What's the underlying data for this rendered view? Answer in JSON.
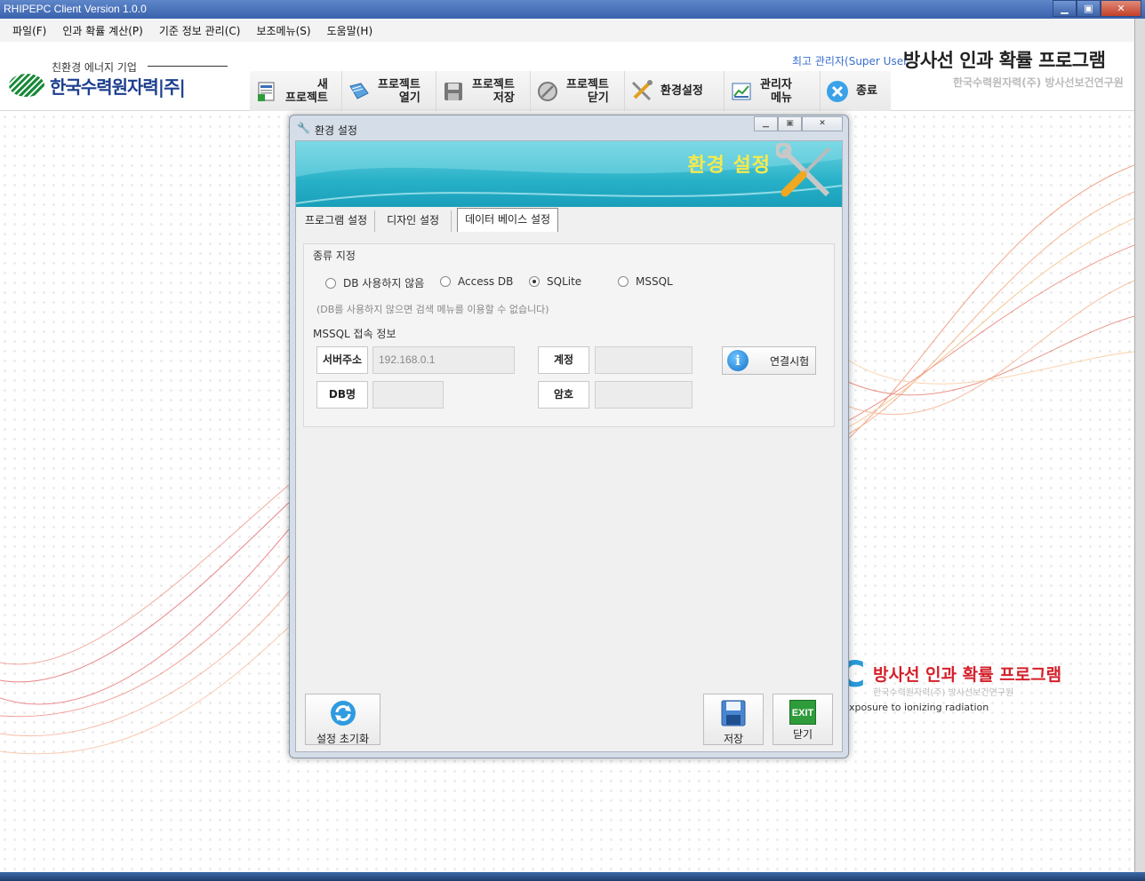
{
  "window": {
    "title": "RHIPEPC Client Version 1.0.0",
    "min": "▁",
    "max": "▣",
    "close": "✕"
  },
  "menu": [
    "파일(F)",
    "인과 확률 계산(P)",
    "기준 정보 관리(C)",
    "보조메뉴(S)",
    "도움말(H)"
  ],
  "logo": {
    "tagline": "친환경 에너지 기업",
    "name": "한국수력원자력|주|"
  },
  "toolbar": [
    {
      "label1": "새",
      "label2": "프로젝트",
      "icon": "new-project-icon"
    },
    {
      "label1": "프로젝트",
      "label2": "열기",
      "icon": "open-project-icon"
    },
    {
      "label1": "프로젝트",
      "label2": "저장",
      "icon": "save-project-icon"
    },
    {
      "label1": "프로젝트",
      "label2": "닫기",
      "icon": "close-project-icon"
    },
    {
      "label1": "환경설정",
      "label2": "",
      "icon": "settings-tools-icon"
    },
    {
      "label1": "관리자",
      "label2": "메뉴",
      "icon": "admin-chart-icon"
    },
    {
      "label1": "종료",
      "label2": "",
      "icon": "exit-x-icon"
    }
  ],
  "header": {
    "user": "최고 관리자(Super User",
    "program_title": "방사선 인과 확률 프로그램",
    "org": "한국수력원자력(주) 방사선보건연구원"
  },
  "background": {
    "title": "방사선 인과 확률 프로그램",
    "org": "한국수력원자력(주) 방사선보건연구원",
    "english": "xposure to ionizing radiation"
  },
  "dialog": {
    "title": "환경 설정",
    "banner_title": "환경 설정",
    "tabs": [
      "프로그램 설정",
      "디자인 설정",
      "데이터 베이스 설정"
    ],
    "active_tab": 2,
    "db_type": {
      "label": "종류 지정",
      "options": [
        "DB 사용하지 않음",
        "Access DB",
        "SQLite",
        "MSSQL"
      ],
      "selected": "SQLite",
      "hint": "(DB를 사용하지 않으면 검색 메뉴를 이용할 수 없습니다)"
    },
    "mssql": {
      "label": "MSSQL 접속 정보",
      "server_label": "서버주소",
      "server_value": "192.168.0.1",
      "db_label": "DB명",
      "db_value": "",
      "account_label": "계정",
      "account_value": "",
      "password_label": "암호",
      "password_value": "",
      "test_button": "연결시험"
    },
    "buttons": {
      "reset": "설정 초기화",
      "save": "저장",
      "close": "닫기",
      "exit_badge": "EXIT"
    }
  },
  "colors": {
    "banner": "#27b1c8",
    "banner_title": "#f5ea4d",
    "accent_red": "#d4202a",
    "titlebar": "#3a62ad"
  }
}
